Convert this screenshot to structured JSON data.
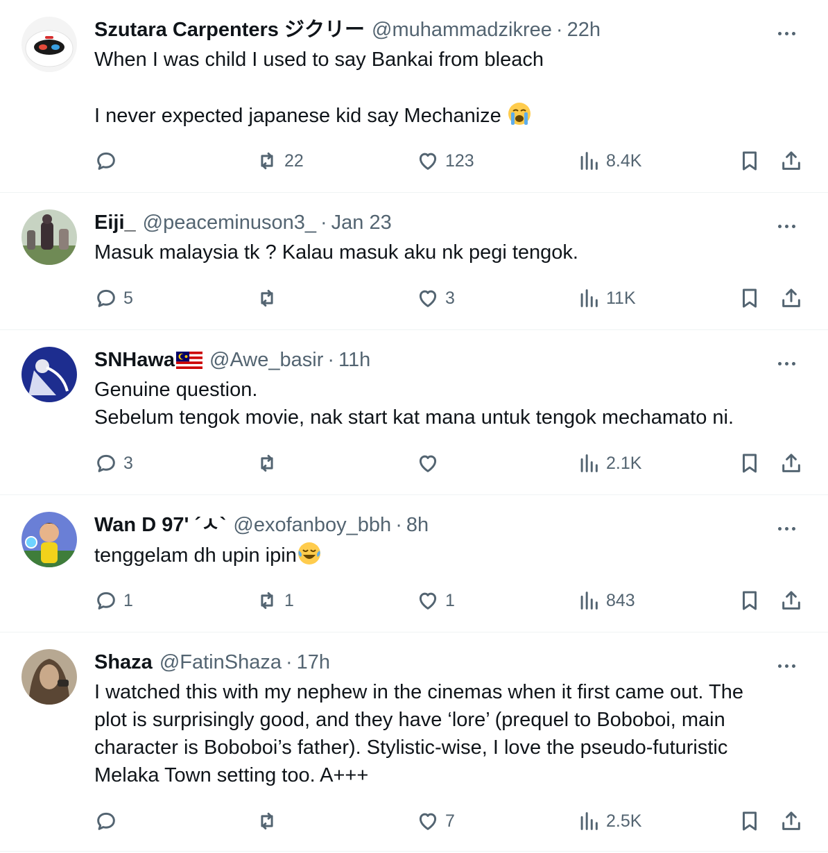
{
  "tweets": [
    {
      "name": "Szutara Carpenters ジクリー",
      "handle": "@muhammadzikree",
      "time": "22h",
      "lines": [
        "When I was child I used to say Bankai from bleach",
        "",
        "I never expected japanese kid say Mechanize"
      ],
      "emoji": "loudly-crying-face",
      "replies": "",
      "retweets": "22",
      "likes": "123",
      "views": "8.4K"
    },
    {
      "name": "Eiji_",
      "handle": "@peaceminuson3_",
      "time": "Jan 23",
      "lines": [
        "Masuk malaysia tk ? Kalau masuk aku nk pegi tengok."
      ],
      "replies": "5",
      "retweets": "",
      "likes": "3",
      "views": "11K"
    },
    {
      "name": "SNHawa",
      "name_flag": "malaysia-flag",
      "handle": "@Awe_basir",
      "time": "11h",
      "lines": [
        "Genuine question.",
        "Sebelum tengok movie, nak start kat mana untuk tengok mechamato ni."
      ],
      "replies": "3",
      "retweets": "",
      "likes": "",
      "views": "2.1K"
    },
    {
      "name": "Wan D 97' ´ㅅ`",
      "handle": "@exofanboy_bbh",
      "time": "8h",
      "lines": [
        "tenggelam dh upin ipin"
      ],
      "emoji": "face-with-tears-of-joy",
      "replies": "1",
      "retweets": "1",
      "likes": "1",
      "views": "843"
    },
    {
      "name": "Shaza",
      "handle": "@FatinShaza",
      "time": "17h",
      "lines": [
        "I watched this with my nephew in the cinemas when it first came out. The",
        "plot is surprisingly good, and they have ‘lore’ (prequel to Boboboi, main",
        "character is Boboboi’s father). Stylistic-wise, I love the pseudo-futuristic",
        "Melaka Town setting too. A+++"
      ],
      "replies": "",
      "retweets": "",
      "likes": "7",
      "views": "2.5K"
    }
  ],
  "separator": "·",
  "colors": {
    "text": "#0f1419",
    "secondary": "#536471",
    "divider": "#eff3f4"
  }
}
